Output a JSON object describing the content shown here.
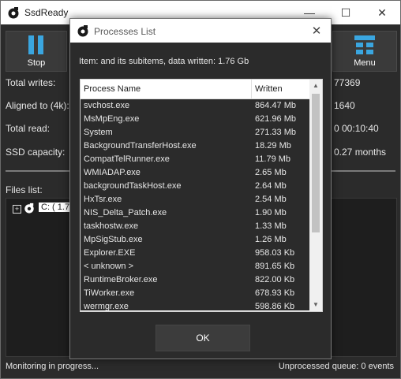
{
  "app": {
    "title": "SsdReady"
  },
  "window_controls": {
    "minimize": "—",
    "maximize": "☐",
    "close": "✕"
  },
  "toolbar": {
    "stop_label": "Stop",
    "menu_label": "Menu"
  },
  "stats": [
    {
      "label": "Total writes:",
      "value": "77369"
    },
    {
      "label": "Aligned to (4k):",
      "value": "1640"
    },
    {
      "label": "Total read:",
      "value": "0 00:10:40"
    },
    {
      "label": "SSD capacity:",
      "value": "0.27 months"
    }
  ],
  "files": {
    "label": "Files list:",
    "expander": "+",
    "root_label": "C: ( 1.7"
  },
  "status": {
    "left": "Monitoring in progress...",
    "right": "Unprocessed queue: 0 events"
  },
  "dialog": {
    "title": "Processes List",
    "close": "✕",
    "item_info": "Item:  and its subitems, data written: 1.76 Gb",
    "columns": {
      "name": "Process Name",
      "written": "Written"
    },
    "rows": [
      {
        "name": "svchost.exe",
        "written": "864.47 Mb"
      },
      {
        "name": "MsMpEng.exe",
        "written": "621.96 Mb"
      },
      {
        "name": "System",
        "written": "271.33 Mb"
      },
      {
        "name": "BackgroundTransferHost.exe",
        "written": "18.29 Mb"
      },
      {
        "name": "CompatTelRunner.exe",
        "written": "11.79 Mb"
      },
      {
        "name": "WMIADAP.exe",
        "written": "2.65 Mb"
      },
      {
        "name": "backgroundTaskHost.exe",
        "written": "2.64 Mb"
      },
      {
        "name": "HxTsr.exe",
        "written": "2.54 Mb"
      },
      {
        "name": "NIS_Delta_Patch.exe",
        "written": "1.90 Mb"
      },
      {
        "name": "taskhostw.exe",
        "written": "1.33 Mb"
      },
      {
        "name": "MpSigStub.exe",
        "written": "1.26 Mb"
      },
      {
        "name": "Explorer.EXE",
        "written": "958.03 Kb"
      },
      {
        "name": "< unknown >",
        "written": "891.65 Kb"
      },
      {
        "name": "RuntimeBroker.exe",
        "written": "822.00 Kb"
      },
      {
        "name": "TiWorker.exe",
        "written": "678.93 Kb"
      },
      {
        "name": "wermgr.exe",
        "written": "598.86 Kb"
      }
    ],
    "scroll_up": "▲",
    "scroll_down": "▼",
    "ok_label": "OK"
  }
}
